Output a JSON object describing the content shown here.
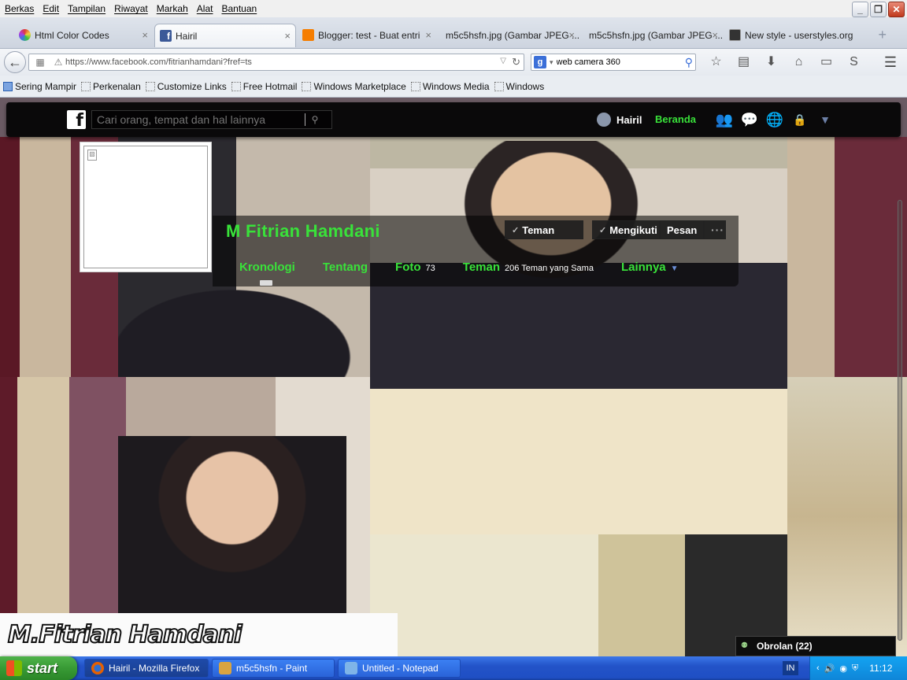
{
  "menubar": {
    "items": [
      "Berkas",
      "Edit",
      "Tampilan",
      "Riwayat",
      "Markah",
      "Alat",
      "Bantuan"
    ]
  },
  "window_controls": {
    "minimize": "_",
    "restore": "❐",
    "close": "✕"
  },
  "tabs": [
    {
      "label": "Html Color Codes",
      "color": "#e03a3a"
    },
    {
      "label": "Hairil",
      "color": "#3b5998"
    },
    {
      "label": "Blogger: test - Buat entri",
      "color": "#f57d00"
    },
    {
      "label": "m5c5hsfn.jpg (Gambar JPEG ...",
      "color": "#ffffff"
    },
    {
      "label": "m5c5hsfn.jpg (Gambar JPEG ...",
      "color": "#ffffff"
    },
    {
      "label": "New style - userstyles.org",
      "color": "#333333"
    }
  ],
  "tab_close": "×",
  "new_tab": "+",
  "navbar": {
    "url": "https://www.facebook.com/fitrianhamdani?fref=ts",
    "search_engine": "g",
    "search_value": "web camera 360"
  },
  "bookmarks": [
    "Sering Mampir",
    "Perkenalan",
    "Customize Links",
    "Free Hotmail",
    "Windows Marketplace",
    "Windows Media",
    "Windows"
  ],
  "facebook": {
    "logo": "f",
    "search_placeholder": "Cari orang, tempat dan hal lainnya",
    "user_name": "Hairil",
    "home_label": "Beranda",
    "accent_color": "#39e23a"
  },
  "profile": {
    "name": "M Fitrian Hamdani",
    "cover_text": "M.Fitrian Hamdani",
    "buttons": {
      "friend": "Teman",
      "follow": "Mengikuti",
      "message": "Pesan",
      "more": "···"
    },
    "tabs": [
      {
        "label": "Kronologi",
        "count": ""
      },
      {
        "label": "Tentang",
        "count": ""
      },
      {
        "label": "Foto",
        "count": "73"
      },
      {
        "label": "Teman",
        "count": "206 Teman yang Sama"
      },
      {
        "label": "Lainnya",
        "count": ""
      }
    ]
  },
  "chat": {
    "label": "Obrolan (22)"
  },
  "taskbar": {
    "start_label": "start",
    "windows": [
      {
        "label": "Hairil - Mozilla Firefox",
        "color": "#e66000"
      },
      {
        "label": "m5c5hsfn - Paint",
        "color": "#d9a441"
      },
      {
        "label": "Untitled - Notepad",
        "color": "#7fb4e8"
      }
    ],
    "lang": "IN",
    "clock": "11:12"
  }
}
